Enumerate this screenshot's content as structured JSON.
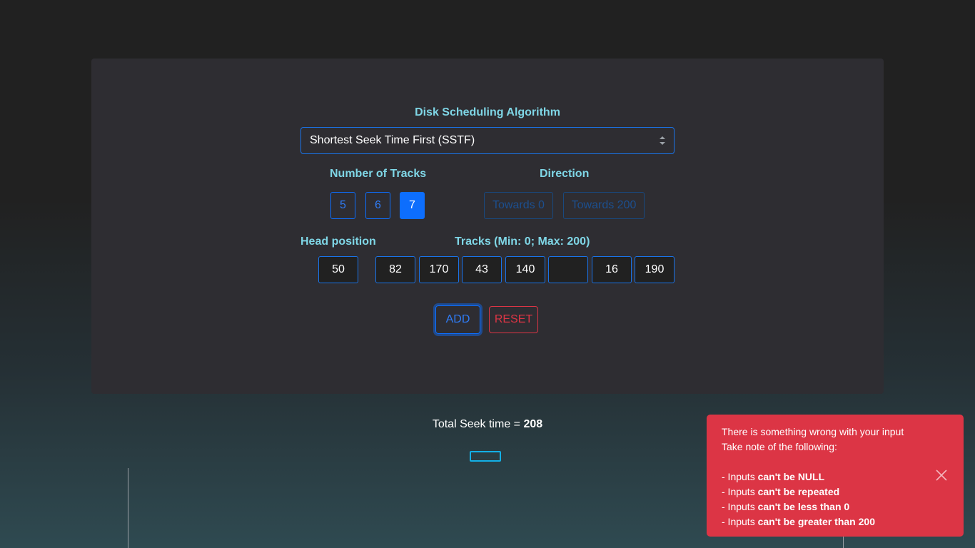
{
  "algorithm": {
    "label": "Disk Scheduling Algorithm",
    "selected": "Shortest Seek Time First (SSTF)"
  },
  "tracks_count": {
    "label": "Number of Tracks",
    "options": [
      "5",
      "6",
      "7"
    ],
    "selected": "7"
  },
  "direction": {
    "label": "Direction",
    "options": [
      "Towards 0",
      "Towards 200"
    ]
  },
  "head": {
    "label": "Head position",
    "value": "50"
  },
  "tracks": {
    "label": "Tracks (Min: 0; Max: 200)",
    "values": [
      "82",
      "170",
      "43",
      "140",
      "",
      "16",
      "190"
    ]
  },
  "actions": {
    "add": "ADD",
    "reset": "RESET"
  },
  "result": {
    "label": "Total Seek time = ",
    "value": "208"
  },
  "toast": {
    "line1": "There is something wrong with your input",
    "line2": "Take note of the following:",
    "rules": [
      {
        "prefix": "- Inputs ",
        "bold": "can't be NULL"
      },
      {
        "prefix": "- Inputs ",
        "bold": "can't be repeated"
      },
      {
        "prefix": "- Inputs ",
        "bold": "can't be less than 0"
      },
      {
        "prefix": "- Inputs ",
        "bold": "can't be greater than 200"
      }
    ]
  },
  "colors": {
    "accent": "#0d6efd",
    "label": "#7fd6e6",
    "danger": "#dc3545",
    "panel": "#2e2d32"
  }
}
